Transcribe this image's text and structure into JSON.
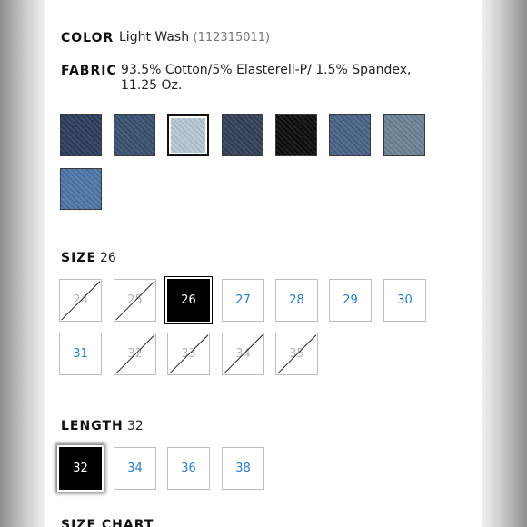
{
  "color": {
    "label": "COLOR",
    "value": "Light Wash",
    "code": "(112315011)"
  },
  "fabric": {
    "label": "FABRIC",
    "line1": "93.5% Cotton/5% Elasterell-P/ 1.5% Spandex,",
    "line2": "11.25 Oz."
  },
  "swatches": [
    {
      "name": "dark-wash",
      "color": "#2c3e5e",
      "selected": false
    },
    {
      "name": "medium-dark-wash",
      "color": "#3a5173",
      "selected": false
    },
    {
      "name": "light-wash",
      "color": "#b7c9d6",
      "selected": true
    },
    {
      "name": "indigo-wash",
      "color": "#33405a",
      "selected": false
    },
    {
      "name": "black",
      "color": "#0d0d0d",
      "selected": false
    },
    {
      "name": "medium-wash",
      "color": "#4a6489",
      "selected": false
    },
    {
      "name": "grey-blue-wash",
      "color": "#6c8499",
      "selected": false
    },
    {
      "name": "bright-medium-wash",
      "color": "#4f77a8",
      "selected": false
    }
  ],
  "size": {
    "label": "SIZE",
    "value": "26",
    "options": [
      {
        "label": "24",
        "state": "disabled"
      },
      {
        "label": "25",
        "state": "disabled"
      },
      {
        "label": "26",
        "state": "selected"
      },
      {
        "label": "27",
        "state": "available"
      },
      {
        "label": "28",
        "state": "available"
      },
      {
        "label": "29",
        "state": "available"
      },
      {
        "label": "30",
        "state": "available"
      },
      {
        "label": "31",
        "state": "available"
      },
      {
        "label": "32",
        "state": "disabled"
      },
      {
        "label": "33",
        "state": "disabled"
      },
      {
        "label": "34",
        "state": "disabled"
      },
      {
        "label": "35",
        "state": "disabled"
      }
    ]
  },
  "length": {
    "label": "LENGTH",
    "value": "32",
    "options": [
      {
        "label": "32",
        "state": "selected"
      },
      {
        "label": "34",
        "state": "available"
      },
      {
        "label": "36",
        "state": "available"
      },
      {
        "label": "38",
        "state": "available"
      }
    ]
  },
  "size_chart": {
    "label": "SIZE CHART"
  }
}
